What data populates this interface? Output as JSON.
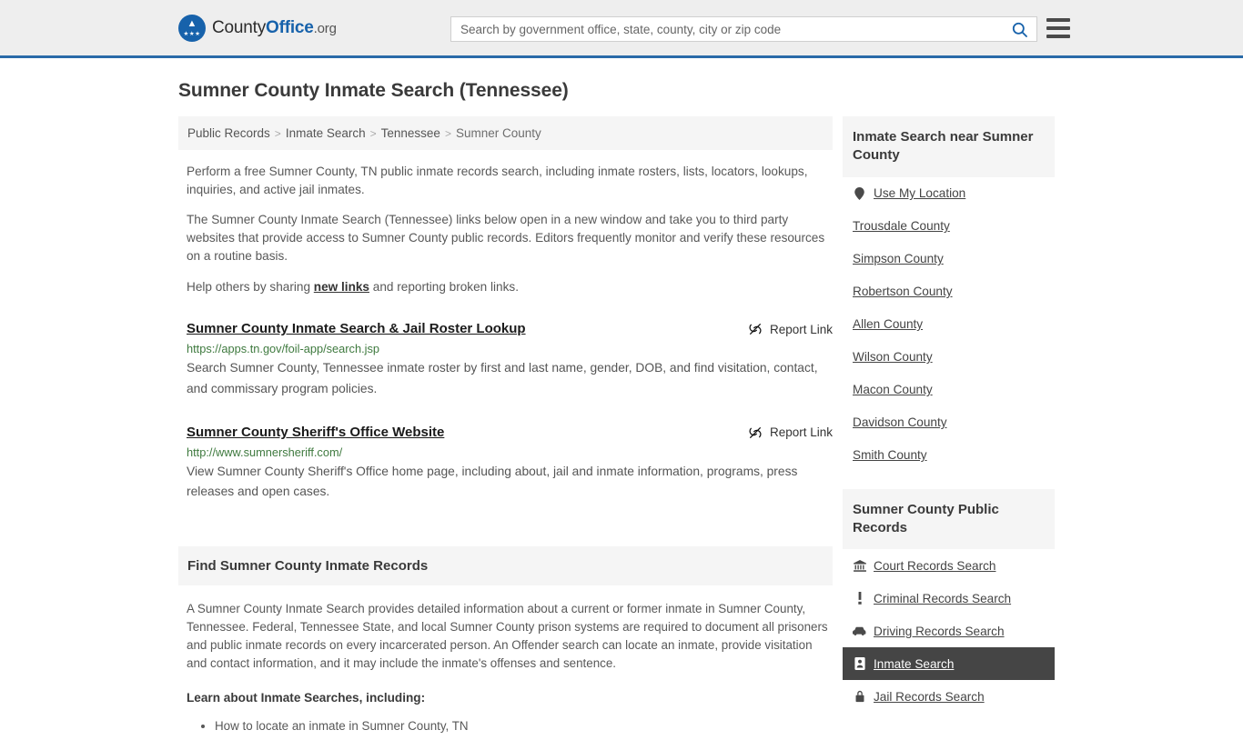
{
  "header": {
    "logo": {
      "part1": "County",
      "part2": "Office",
      "tld": ".org",
      "eagle_icon": "eagle-icon"
    },
    "search": {
      "placeholder": "Search by government office, state, county, city or zip code",
      "value": "",
      "search_icon": "search-icon"
    },
    "menu_icon": "hamburger-menu-icon"
  },
  "page": {
    "title": "Sumner County Inmate Search (Tennessee)"
  },
  "breadcrumb": {
    "items": [
      "Public Records",
      "Inmate Search",
      "Tennessee",
      "Sumner County"
    ],
    "separator": ">"
  },
  "intro": {
    "p1": "Perform a free Sumner County, TN public inmate records search, including inmate rosters, lists, locators, lookups, inquiries, and active jail inmates.",
    "p2": "The Sumner County Inmate Search (Tennessee) links below open in a new window and take you to third party websites that provide access to Sumner County public records. Editors frequently monitor and verify these resources on a routine basis.",
    "p3_before": "Help others by sharing ",
    "p3_link": "new links",
    "p3_after": " and reporting broken links."
  },
  "results": [
    {
      "title": "Sumner County Inmate Search & Jail Roster Lookup",
      "url": "https://apps.tn.gov/foil-app/search.jsp",
      "description": "Search Sumner County, Tennessee inmate roster by first and last name, gender, DOB, and find visitation, contact, and commissary program policies.",
      "report_label": "Report Link",
      "report_icon": "broken-link-icon"
    },
    {
      "title": "Sumner County Sheriff's Office Website",
      "url": "http://www.sumnersheriff.com/",
      "description": "View Sumner County Sheriff's Office home page, including about, jail and inmate information, programs, press releases and open cases.",
      "report_label": "Report Link",
      "report_icon": "broken-link-icon"
    }
  ],
  "section": {
    "heading": "Find Sumner County Inmate Records",
    "body": "A Sumner County Inmate Search provides detailed information about a current or former inmate in Sumner County, Tennessee. Federal, Tennessee State, and local Sumner County prison systems are required to document all prisoners and public inmate records on every incarcerated person. An Offender search can locate an inmate, provide visitation and contact information, and it may include the inmate's offenses and sentence.",
    "subheading": "Learn about Inmate Searches, including:",
    "bullets": [
      "How to locate an inmate in Sumner County, TN"
    ]
  },
  "sidebar": {
    "nearby": {
      "heading": "Inmate Search near Sumner County",
      "items": [
        {
          "label": "Use My Location",
          "icon": "location-pin-icon",
          "active": false
        },
        {
          "label": "Trousdale County",
          "icon": "",
          "active": false
        },
        {
          "label": "Simpson County",
          "icon": "",
          "active": false
        },
        {
          "label": "Robertson County",
          "icon": "",
          "active": false
        },
        {
          "label": "Allen County",
          "icon": "",
          "active": false
        },
        {
          "label": "Wilson County",
          "icon": "",
          "active": false
        },
        {
          "label": "Macon County",
          "icon": "",
          "active": false
        },
        {
          "label": "Davidson County",
          "icon": "",
          "active": false
        },
        {
          "label": "Smith County",
          "icon": "",
          "active": false
        }
      ]
    },
    "records": {
      "heading": "Sumner County Public Records",
      "items": [
        {
          "label": "Court Records Search",
          "icon": "courthouse-icon",
          "active": false
        },
        {
          "label": "Criminal Records Search",
          "icon": "exclamation-icon",
          "active": false
        },
        {
          "label": "Driving Records Search",
          "icon": "car-icon",
          "active": false
        },
        {
          "label": "Inmate Search",
          "icon": "id-card-icon",
          "active": true
        },
        {
          "label": "Jail Records Search",
          "icon": "lock-icon",
          "active": false
        }
      ]
    }
  },
  "colors": {
    "brand_blue": "#1762ab",
    "header_border": "#2a6aa8",
    "header_bg": "#eeeeee",
    "panel_bg": "#f5f5f5",
    "url_green": "#3f7a3f",
    "active_bg": "#454545"
  }
}
